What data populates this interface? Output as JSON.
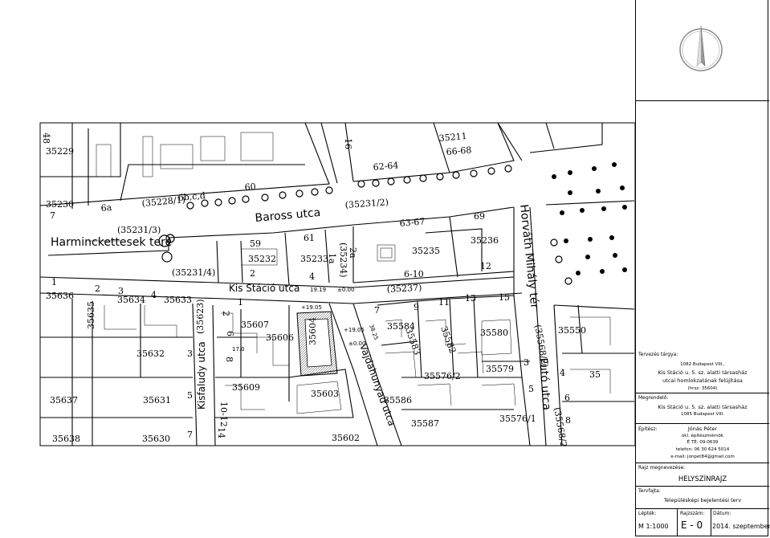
{
  "map": {
    "streets": {
      "baross": "Baross utca",
      "harminckettesek": "Harminckettesek tere",
      "kis_stacio": "Kis Stáció utca",
      "kisfaludy": "Kisfaludy utca",
      "vajdahunyad": "Vajdahunyad utca",
      "horvath": "Horváth Mihály tér",
      "futo": "Futó utca"
    },
    "lots": [
      {
        "id": "l1",
        "text": "35229"
      },
      {
        "id": "l2",
        "text": "35230"
      },
      {
        "id": "l3",
        "text": "7"
      },
      {
        "id": "l4",
        "text": "6a"
      },
      {
        "id": "l5",
        "text": "(35228/1)"
      },
      {
        "id": "l6",
        "text": "6b,c,d"
      },
      {
        "id": "l7",
        "text": "60"
      },
      {
        "id": "l8",
        "text": "(35231/3)"
      },
      {
        "id": "l9",
        "text": "(35231/2)"
      },
      {
        "id": "l10",
        "text": "62-64"
      },
      {
        "id": "l11",
        "text": "63-67"
      },
      {
        "id": "l12",
        "text": "66-68"
      },
      {
        "id": "l13",
        "text": "35211"
      },
      {
        "id": "l14",
        "text": "16"
      },
      {
        "id": "l15",
        "text": "59"
      },
      {
        "id": "l16",
        "text": "61"
      },
      {
        "id": "l17",
        "text": "35232"
      },
      {
        "id": "l18",
        "text": "35233"
      },
      {
        "id": "l19",
        "text": "1a"
      },
      {
        "id": "l20",
        "text": "2a"
      },
      {
        "id": "l21",
        "text": "(35234)"
      },
      {
        "id": "l22",
        "text": "35235"
      },
      {
        "id": "l23",
        "text": "35236"
      },
      {
        "id": "l24",
        "text": "69"
      },
      {
        "id": "l25",
        "text": "6-10"
      },
      {
        "id": "l26",
        "text": "12"
      },
      {
        "id": "l27",
        "text": "(35231/4)"
      },
      {
        "id": "l28",
        "text": "2"
      },
      {
        "id": "l29",
        "text": "4"
      },
      {
        "id": "l30",
        "text": "(35237)"
      },
      {
        "id": "l31",
        "text": "35636"
      },
      {
        "id": "l32",
        "text": "35634"
      },
      {
        "id": "l33",
        "text": "35633"
      },
      {
        "id": "l34",
        "text": "3"
      },
      {
        "id": "l35",
        "text": "4"
      },
      {
        "id": "l36",
        "text": "1"
      },
      {
        "id": "l37",
        "text": "2"
      },
      {
        "id": "l38",
        "text": "35607"
      },
      {
        "id": "l39",
        "text": "35606"
      },
      {
        "id": "l40",
        "text": "35604"
      },
      {
        "id": "l41",
        "text": "(35623)"
      },
      {
        "id": "l42",
        "text": "7"
      },
      {
        "id": "l43",
        "text": "9"
      },
      {
        "id": "l44",
        "text": "11"
      },
      {
        "id": "l45",
        "text": "13"
      },
      {
        "id": "l46",
        "text": "15"
      },
      {
        "id": "l47",
        "text": "35584"
      },
      {
        "id": "l48",
        "text": "35583"
      },
      {
        "id": "l49",
        "text": "35582"
      },
      {
        "id": "l50",
        "text": "35580"
      },
      {
        "id": "l51",
        "text": "(35568/2)"
      },
      {
        "id": "l52",
        "text": "35550"
      },
      {
        "id": "l53",
        "text": "35632"
      },
      {
        "id": "l54",
        "text": "35579"
      },
      {
        "id": "l55",
        "text": "35576/2"
      },
      {
        "id": "l56",
        "text": "35637"
      },
      {
        "id": "l57",
        "text": "35631"
      },
      {
        "id": "l58",
        "text": "35609"
      },
      {
        "id": "l59",
        "text": "35603"
      },
      {
        "id": "l60",
        "text": "35586"
      },
      {
        "id": "l61",
        "text": "35587"
      },
      {
        "id": "l62",
        "text": "35576/1"
      },
      {
        "id": "l63",
        "text": "35638"
      },
      {
        "id": "l64",
        "text": "35630"
      },
      {
        "id": "l65",
        "text": "35602"
      },
      {
        "id": "l66",
        "text": "10-12"
      },
      {
        "id": "l67",
        "text": "14"
      },
      {
        "id": "l68",
        "text": "8"
      },
      {
        "id": "l69",
        "text": "6"
      },
      {
        "id": "l70",
        "text": "3"
      },
      {
        "id": "l71",
        "text": "5"
      },
      {
        "id": "l72",
        "text": "35"
      },
      {
        "id": "l73",
        "text": "48"
      },
      {
        "id": "l74",
        "text": "1"
      },
      {
        "id": "l75",
        "text": "2"
      },
      {
        "id": "l76",
        "text": "3"
      },
      {
        "id": "l77",
        "text": "5"
      },
      {
        "id": "l78",
        "text": "7"
      },
      {
        "id": "l79",
        "text": "8"
      },
      {
        "id": "l80",
        "text": "4"
      },
      {
        "id": "l81",
        "text": "6"
      },
      {
        "id": "l82",
        "text": "(35568/2)"
      },
      {
        "id": "l83",
        "text": "35635"
      }
    ],
    "elevations": [
      "19.19",
      "±0.00",
      "+19.05",
      "+19.05",
      "±0.00",
      "38.25",
      "17.0"
    ]
  },
  "title_block": {
    "project_label": "Tervezés tárgya:",
    "project_address": "1082 Budapest VIII.,",
    "project_line1": "Kis Stáció u. 5. sz. alatti társasház",
    "project_line2": "utcai homlokzatának felújítása",
    "project_hrsz": "(hrsz: 35604)",
    "client_label": "Megrendelő:",
    "client_line1": "Kis Stáció u. 5. sz. alatti társasház",
    "client_line2": "1085 Budapest VIII.",
    "architect_label": "Építész:",
    "architect_name": "Jónás Péter",
    "architect_title": "okl. építészmérnök",
    "architect_reg": "É  TÉ: 09-0639",
    "architect_phone": "telefon: 06 30 624 5014",
    "architect_email": "e-mail: jonpet84@gmail.com",
    "drawing_label": "Rajz megnevezése:",
    "drawing_name": "HELYSZÍNRAJZ",
    "plan_type_label": "Tervfajta:",
    "plan_type": "Településképi bejelentési terv",
    "scale_label": "Lépték:",
    "scale": "M  1:1000",
    "number_label": "Rajzszám:",
    "number": "E - 0",
    "date_label": "Dátum:",
    "date": "2014. szeptember"
  }
}
